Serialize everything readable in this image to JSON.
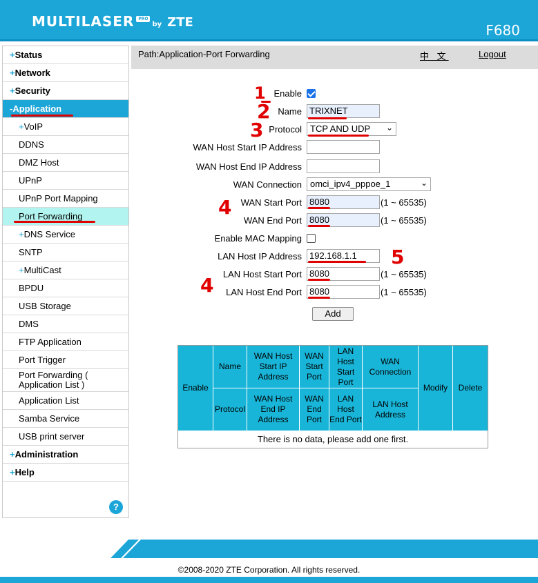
{
  "header": {
    "brand": "MULTILASER",
    "brand_tag": "PRO",
    "brand_by": "by",
    "brand_zte": "ZTE",
    "model": "F680"
  },
  "sidebar": {
    "items": [
      {
        "sign": "+",
        "label": "Status"
      },
      {
        "sign": "+",
        "label": "Network"
      },
      {
        "sign": "+",
        "label": "Security"
      },
      {
        "sign": "-",
        "label": "Application"
      },
      {
        "sign": "+",
        "label": "VoIP"
      },
      {
        "label": "DDNS"
      },
      {
        "label": "DMZ Host"
      },
      {
        "label": "UPnP"
      },
      {
        "label": "UPnP Port Mapping"
      },
      {
        "label": "Port Forwarding"
      },
      {
        "sign": "+",
        "label": "DNS Service"
      },
      {
        "label": "SNTP"
      },
      {
        "sign": "+",
        "label": "MultiCast"
      },
      {
        "label": "BPDU"
      },
      {
        "label": "USB Storage"
      },
      {
        "label": "DMS"
      },
      {
        "label": "FTP Application"
      },
      {
        "label": "Port Trigger"
      },
      {
        "label": "Port Forwarding ( Application List )"
      },
      {
        "label": "Application List"
      },
      {
        "label": "Samba Service"
      },
      {
        "label": "USB print server"
      },
      {
        "sign": "+",
        "label": "Administration"
      },
      {
        "sign": "+",
        "label": "Help"
      }
    ],
    "help_icon": "?"
  },
  "pathbar": {
    "path": "Path:Application-Port Forwarding",
    "lang": "中 文",
    "logout": "Logout"
  },
  "form": {
    "enable_label": "Enable",
    "enable_checked": true,
    "name_label": "Name",
    "name_value": "TRIXNET",
    "protocol_label": "Protocol",
    "protocol_value": "TCP AND UDP",
    "wan_host_start_label": "WAN Host Start IP Address",
    "wan_host_start_value": "",
    "wan_host_end_label": "WAN Host End IP Address",
    "wan_host_end_value": "",
    "wan_connection_label": "WAN Connection",
    "wan_connection_value": "omci_ipv4_pppoe_1",
    "wan_start_port_label": "WAN Start Port",
    "wan_start_port_value": "8080",
    "wan_end_port_label": "WAN End Port",
    "wan_end_port_value": "8080",
    "mac_mapping_label": "Enable MAC Mapping",
    "mac_mapping_checked": false,
    "lan_host_ip_label": "LAN Host IP Address",
    "lan_host_ip_value": "192.168.1.1",
    "lan_host_start_label": "LAN Host Start Port",
    "lan_host_start_value": "8080",
    "lan_host_end_label": "LAN Host End Port",
    "lan_host_end_value": "8080",
    "port_range": "(1 ~ 65535)",
    "add_button": "Add"
  },
  "table": {
    "headers": {
      "enable": "Enable",
      "name": "Name",
      "wan_host_start": "WAN Host Start IP Address",
      "wan_start_port": "WAN Start Port",
      "lan_host_start_port": "LAN Host Start Port",
      "wan_connection": "WAN Connection",
      "modify": "Modify",
      "delete": "Delete",
      "protocol": "Protocol",
      "wan_host_end": "WAN Host End IP Address",
      "wan_end_port": "WAN End Port",
      "lan_host_end_port": "LAN Host End Port",
      "lan_host_address": "LAN Host Address"
    },
    "empty_message": "There is no data, please add one first."
  },
  "annotations": {
    "a1": "1",
    "a2": "2",
    "a3": "3",
    "a4a": "4",
    "a4b": "4",
    "a5": "5"
  },
  "footer": {
    "copyright": "©2008-2020 ZTE Corporation. All rights reserved."
  },
  "colors": {
    "accent": "#1ca6d8",
    "selected": "#b2f4ef",
    "annotation": "#e00000"
  }
}
